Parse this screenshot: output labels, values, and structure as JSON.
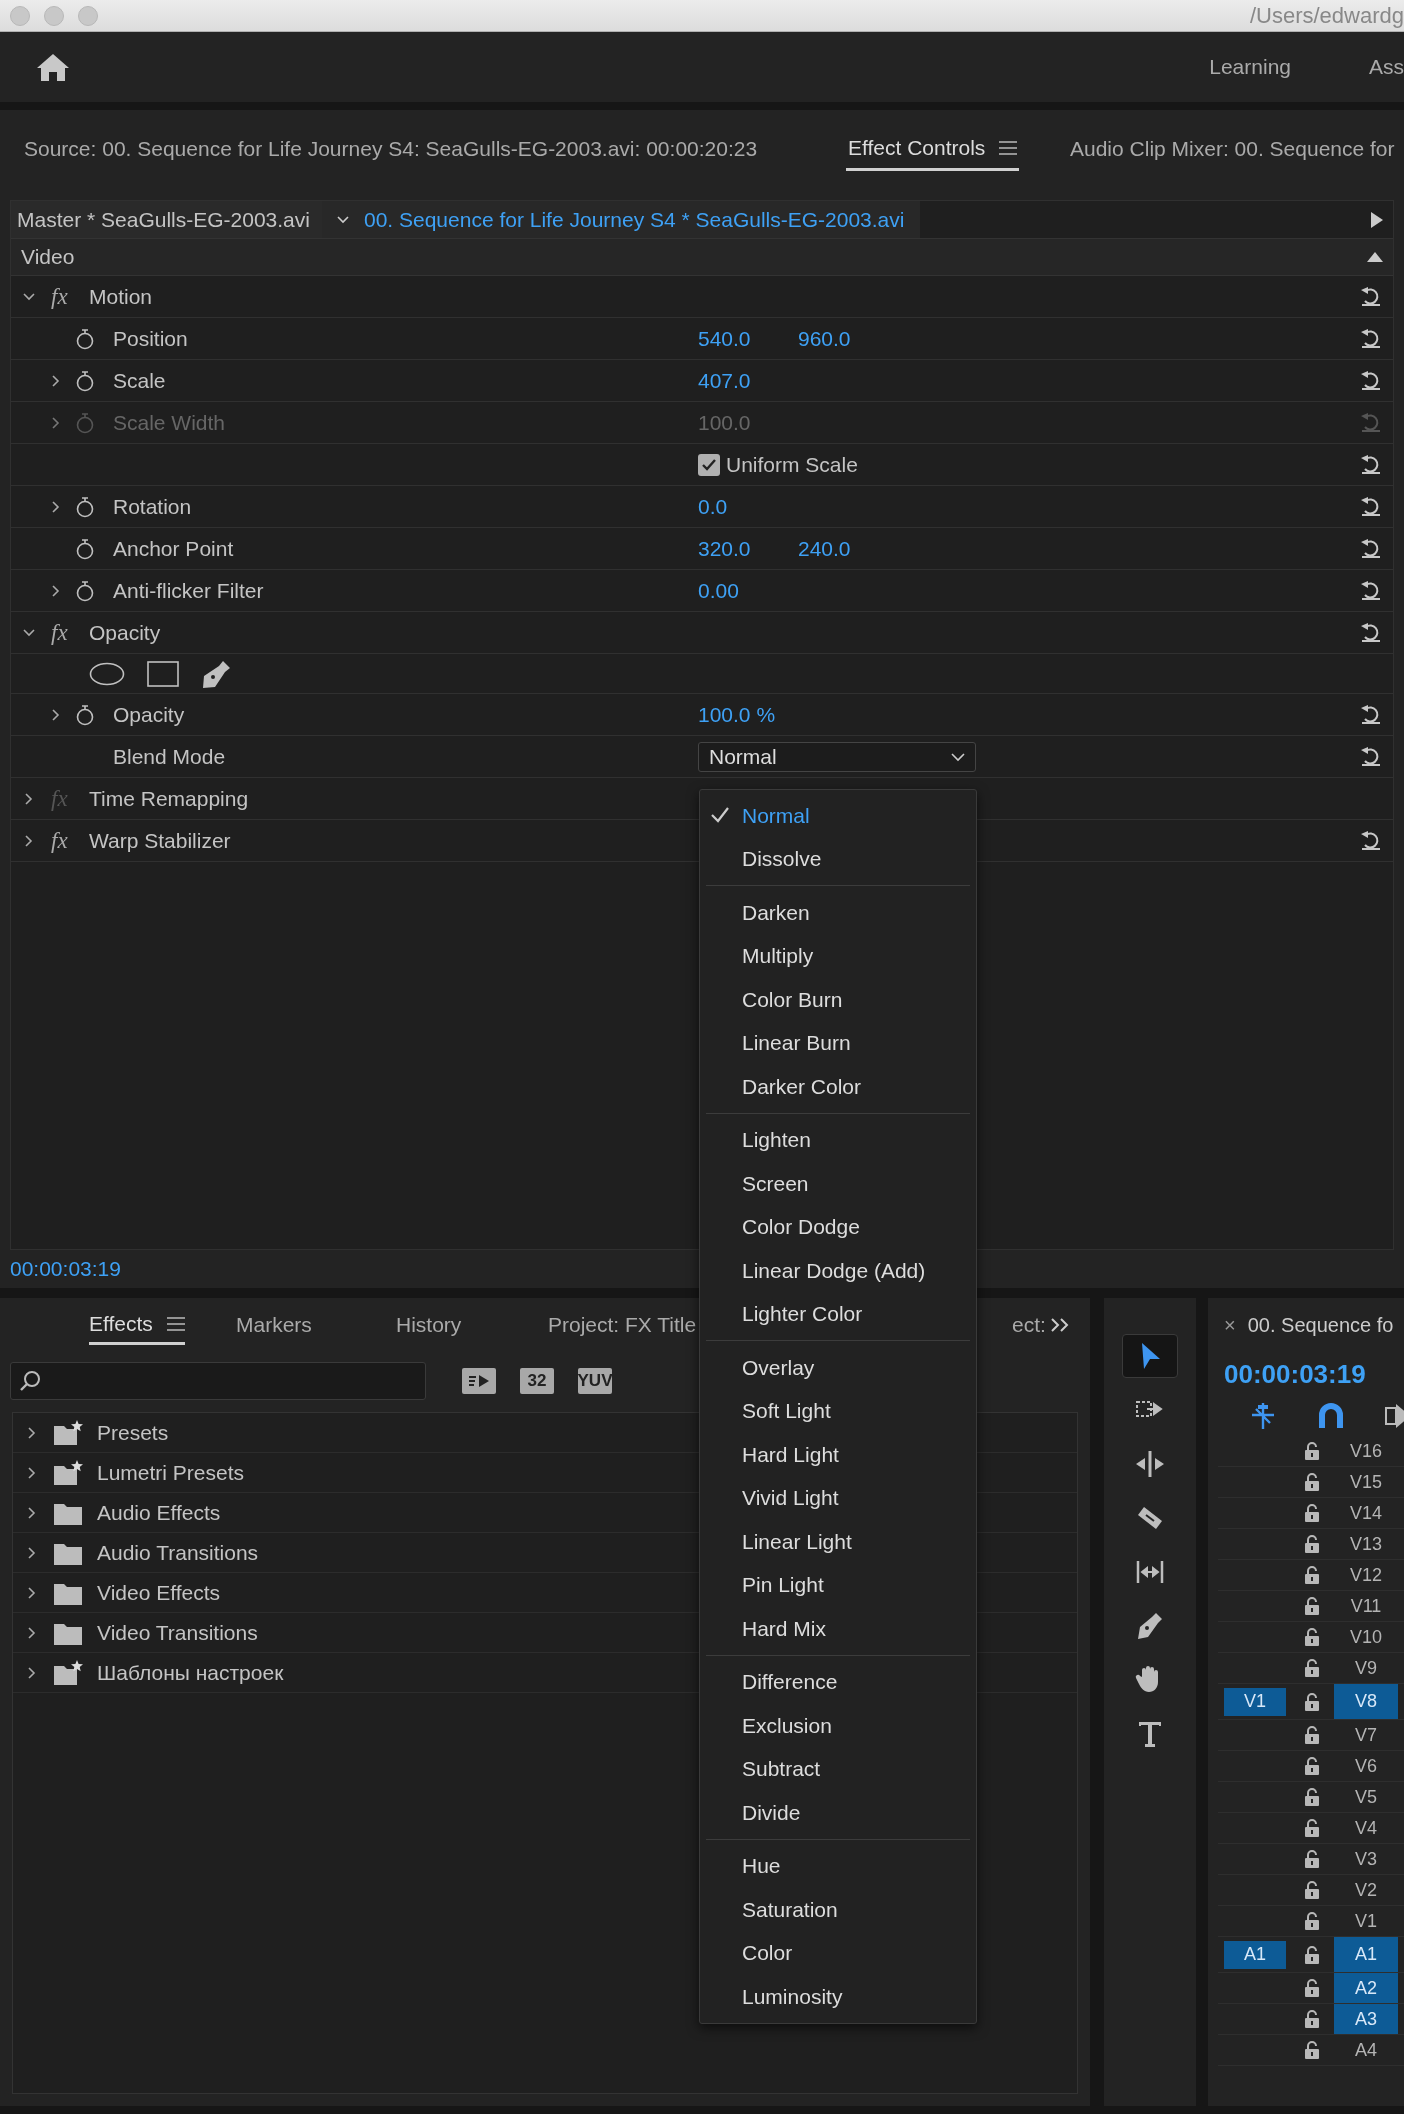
{
  "titlebar": {
    "path": "/Users/edwardg"
  },
  "header": {
    "workspaces": [
      "Learning",
      "Ass"
    ]
  },
  "panel_tabs": [
    {
      "label": "Source: 00. Sequence for Life Journey S4: SeaGulls-EG-2003.avi: 00:00:20:23",
      "selected": false
    },
    {
      "label": "Effect Controls",
      "selected": true
    },
    {
      "label": "Audio Clip Mixer: 00. Sequence for",
      "selected": false
    }
  ],
  "clip_header": {
    "master": "Master * SeaGulls-EG-2003.avi",
    "sequence": "00. Sequence for Life Journey S4 * SeaGulls-EG-2003.avi"
  },
  "section": "Video",
  "effects": [
    {
      "badge": "fx",
      "name": "Motion",
      "expanded": true,
      "enabled": true,
      "reset": true,
      "properties": [
        {
          "kind": "param",
          "label": "Position",
          "values": [
            "540.0",
            "960.0"
          ],
          "expandable": false,
          "disabled": false
        },
        {
          "kind": "param",
          "label": "Scale",
          "values": [
            "407.0"
          ],
          "expandable": true,
          "disabled": false
        },
        {
          "kind": "param",
          "label": "Scale Width",
          "values": [
            "100.0"
          ],
          "expandable": true,
          "disabled": true
        },
        {
          "kind": "checkbox",
          "label": "Uniform Scale",
          "checked": true
        },
        {
          "kind": "param",
          "label": "Rotation",
          "values": [
            "0.0"
          ],
          "expandable": true,
          "disabled": false
        },
        {
          "kind": "param",
          "label": "Anchor Point",
          "values": [
            "320.0",
            "240.0"
          ],
          "expandable": false,
          "disabled": false
        },
        {
          "kind": "param",
          "label": "Anti-flicker Filter",
          "values": [
            "0.00"
          ],
          "expandable": true,
          "disabled": false
        }
      ]
    },
    {
      "badge": "fx",
      "name": "Opacity",
      "expanded": true,
      "enabled": true,
      "reset": true,
      "properties": [
        {
          "kind": "masks"
        },
        {
          "kind": "param",
          "label": "Opacity",
          "values": [
            "100.0 %"
          ],
          "expandable": true,
          "disabled": false
        },
        {
          "kind": "dropdown",
          "label": "Blend Mode",
          "value": "Normal"
        }
      ]
    },
    {
      "badge": "fx",
      "name": "Time Remapping",
      "expanded": false,
      "enabled": false,
      "reset": false
    },
    {
      "badge": "fx",
      "name": "Warp Stabilizer",
      "expanded": false,
      "enabled": true,
      "reset": true
    }
  ],
  "timecode": "00:00:03:19",
  "blend_menu": {
    "groups": [
      [
        {
          "label": "Normal",
          "selected": true
        },
        {
          "label": "Dissolve",
          "selected": false
        }
      ],
      [
        {
          "label": "Darken",
          "selected": false
        },
        {
          "label": "Multiply",
          "selected": false
        },
        {
          "label": "Color Burn",
          "selected": false
        },
        {
          "label": "Linear Burn",
          "selected": false
        },
        {
          "label": "Darker Color",
          "selected": false
        }
      ],
      [
        {
          "label": "Lighten",
          "selected": false
        },
        {
          "label": "Screen",
          "selected": false
        },
        {
          "label": "Color Dodge",
          "selected": false
        },
        {
          "label": "Linear Dodge (Add)",
          "selected": false
        },
        {
          "label": "Lighter Color",
          "selected": false
        }
      ],
      [
        {
          "label": "Overlay",
          "selected": false
        },
        {
          "label": "Soft Light",
          "selected": false
        },
        {
          "label": "Hard Light",
          "selected": false
        },
        {
          "label": "Vivid Light",
          "selected": false
        },
        {
          "label": "Linear Light",
          "selected": false
        },
        {
          "label": "Pin Light",
          "selected": false
        },
        {
          "label": "Hard Mix",
          "selected": false
        }
      ],
      [
        {
          "label": "Difference",
          "selected": false
        },
        {
          "label": "Exclusion",
          "selected": false
        },
        {
          "label": "Subtract",
          "selected": false
        },
        {
          "label": "Divide",
          "selected": false
        }
      ],
      [
        {
          "label": "Hue",
          "selected": false
        },
        {
          "label": "Saturation",
          "selected": false
        },
        {
          "label": "Color",
          "selected": false
        },
        {
          "label": "Luminosity",
          "selected": false
        }
      ]
    ]
  },
  "effects_panel": {
    "tabs": [
      {
        "label": "Effects",
        "selected": true
      },
      {
        "label": "Markers",
        "selected": false
      },
      {
        "label": "History",
        "selected": false
      },
      {
        "label": "Project: FX Title",
        "selected": false
      },
      {
        "label": "ect:",
        "selected": false
      }
    ],
    "filters": [
      {
        "kind": "accelerated"
      },
      {
        "kind": "text",
        "label": "32"
      },
      {
        "kind": "text",
        "label": "YUV"
      }
    ],
    "tree": [
      {
        "kind": "preset",
        "label": "Presets",
        "expanded": false
      },
      {
        "kind": "preset",
        "label": "Lumetri Presets",
        "expanded": false
      },
      {
        "kind": "folder",
        "label": "Audio Effects",
        "expanded": false
      },
      {
        "kind": "folder",
        "label": "Audio Transitions",
        "expanded": false
      },
      {
        "kind": "folder",
        "label": "Video Effects",
        "expanded": false
      },
      {
        "kind": "folder",
        "label": "Video Transitions",
        "expanded": false
      },
      {
        "kind": "preset",
        "label": "Шаблоны настроек",
        "expanded": false
      }
    ]
  },
  "tools": [
    {
      "kind": "selection",
      "selected": true
    },
    {
      "kind": "track-select",
      "selected": false
    },
    {
      "kind": "ripple",
      "selected": false
    },
    {
      "kind": "razor",
      "selected": false
    },
    {
      "kind": "slip",
      "selected": false
    },
    {
      "kind": "pen",
      "selected": false
    },
    {
      "kind": "hand",
      "selected": false
    },
    {
      "kind": "type",
      "selected": false
    }
  ],
  "timeline": {
    "close": "×",
    "title": "00. Sequence fo",
    "timecode": "00:00:03:19",
    "tracks": [
      {
        "label": "V16",
        "targeted": false
      },
      {
        "label": "V15",
        "targeted": false
      },
      {
        "label": "V14",
        "targeted": false
      },
      {
        "label": "V13",
        "targeted": false
      },
      {
        "label": "V12",
        "targeted": false
      },
      {
        "label": "V11",
        "targeted": false
      },
      {
        "label": "V10",
        "targeted": false
      },
      {
        "label": "V9",
        "targeted": false
      },
      {
        "label": "V8",
        "targeted": true,
        "source": "V1"
      },
      {
        "label": "V7",
        "targeted": false
      },
      {
        "label": "V6",
        "targeted": false
      },
      {
        "label": "V5",
        "targeted": false
      },
      {
        "label": "V4",
        "targeted": false
      },
      {
        "label": "V3",
        "targeted": false
      },
      {
        "label": "V2",
        "targeted": false
      },
      {
        "label": "V1",
        "targeted": false
      },
      {
        "label": "A1",
        "targeted": true,
        "source": "A1"
      },
      {
        "label": "A2",
        "targeted": true
      },
      {
        "label": "A3",
        "targeted": true
      },
      {
        "label": "A4",
        "targeted": false
      }
    ]
  }
}
